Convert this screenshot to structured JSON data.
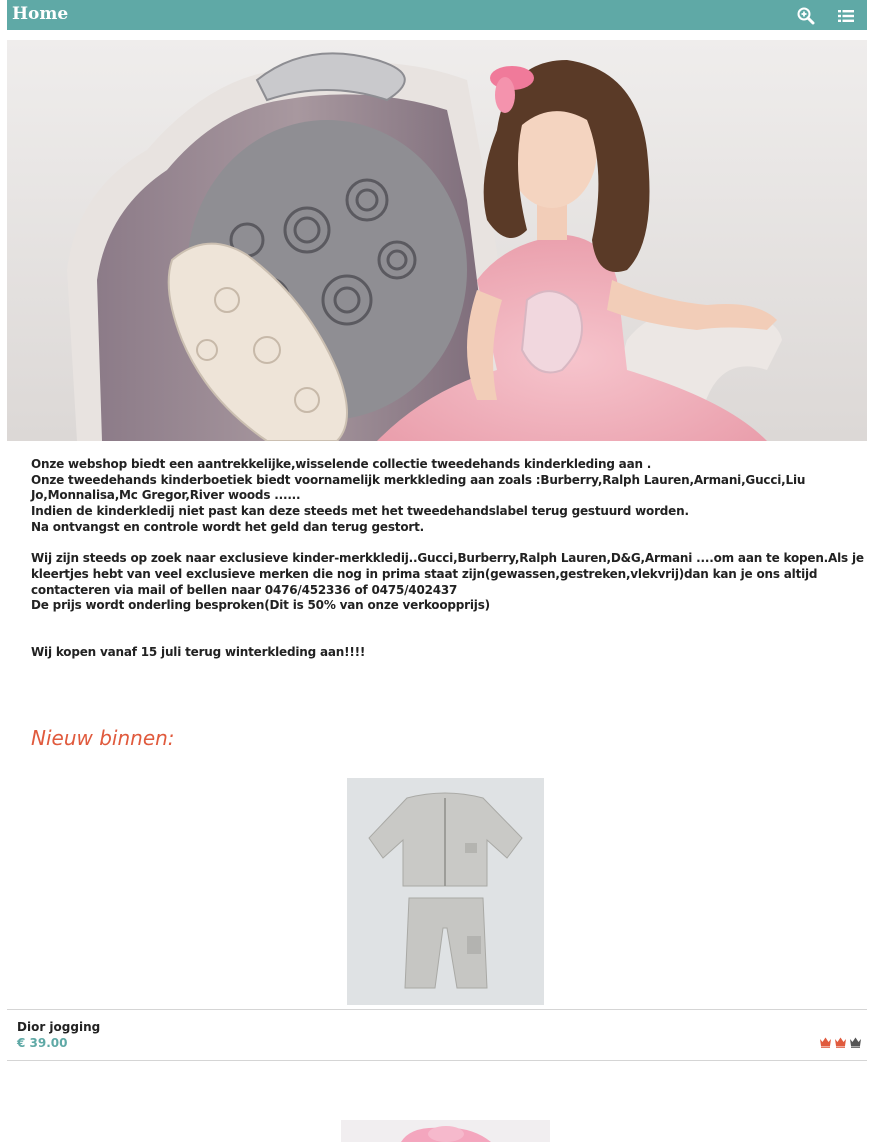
{
  "header": {
    "title": "Home",
    "icons": [
      "zoom-in-icon",
      "list-menu-icon"
    ],
    "bg_color": "#5fa9a6"
  },
  "intro": {
    "lines": [
      "Onze webshop biedt een aantrekkelijke,wisselende collectie tweedehands kinderkleding aan .",
      "Onze tweedehands kinderboetiek biedt voornamelijk merkkleding aan zoals :Burberry,Ralph Lauren,Armani,Gucci,Liu Jo,Monnalisa,Mc Gregor,River woods ......",
      "Indien de kinderkledij niet past kan deze steeds met het tweedehandslabel terug gestuurd worden.",
      "Na ontvangst en controle wordt het geld dan terug gestort.",
      "Wij zijn steeds op zoek naar exclusieve kinder-merkkledij..Gucci,Burberry,Ralph Lauren,D&G,Armani ....om aan te kopen.Als je kleertjes hebt van veel exclusieve merken die nog in prima staat zijn(gewassen,gestreken,vlekvrij)dan kan je ons altijd contacteren via mail of bellen naar 0476/452336 of 0475/402437",
      "De prijs wordt onderling besproken(Dit is 50% van onze verkoopprijs)",
      "Wij kopen vanaf 15 juli terug winterkleding aan!!!!"
    ]
  },
  "new_in": {
    "title": "Nieuw binnen:",
    "accent_color": "#e05a3d",
    "products": [
      {
        "name": "Dior jogging",
        "price": "€ 39.00",
        "rating": 2,
        "rating_max": 3
      }
    ]
  }
}
